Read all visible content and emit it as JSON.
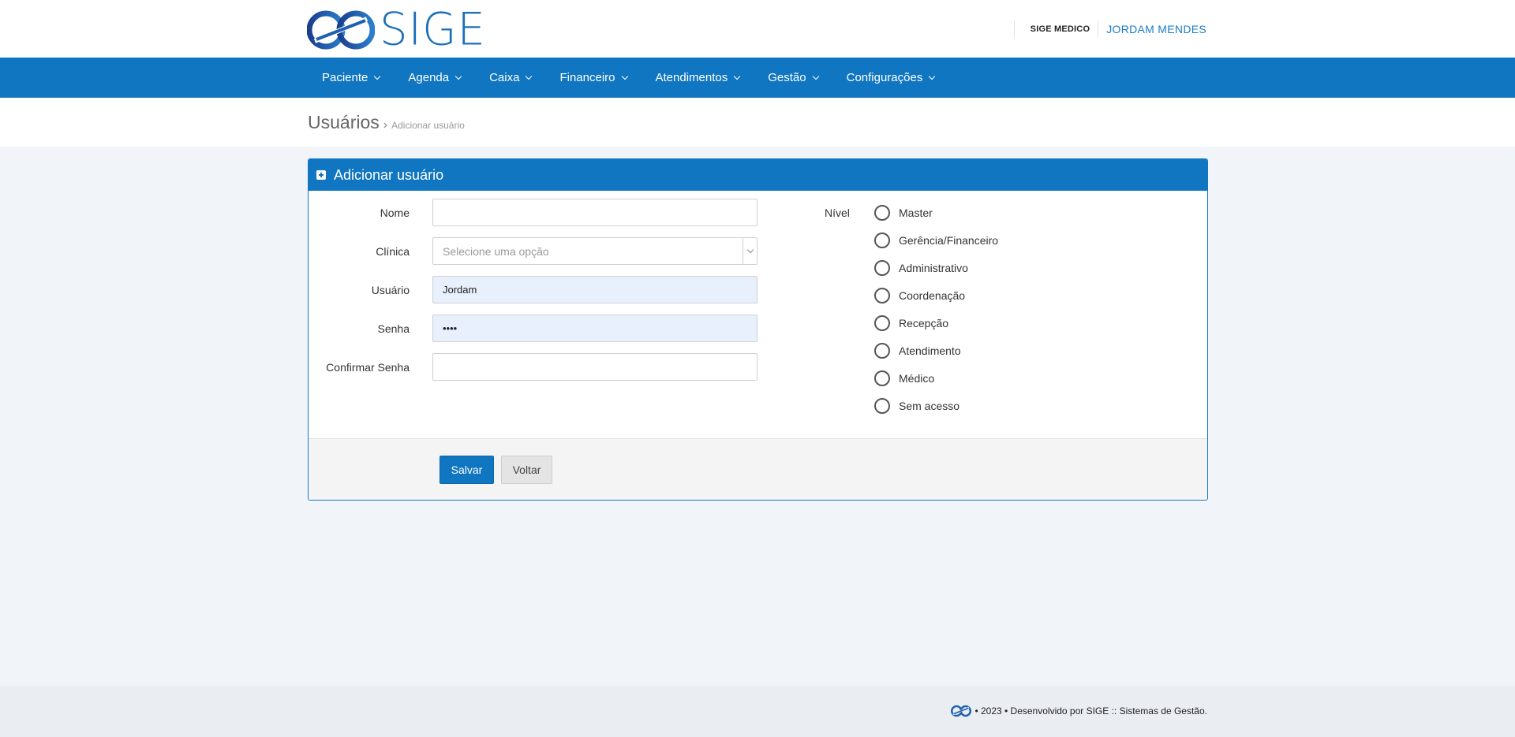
{
  "header": {
    "logo_text": "SIGE",
    "app_label": "SIGE MEDICO",
    "user_name": "JORDAM MENDES"
  },
  "nav": {
    "items": [
      {
        "label": "Paciente"
      },
      {
        "label": "Agenda"
      },
      {
        "label": "Caixa"
      },
      {
        "label": "Financeiro"
      },
      {
        "label": "Atendimentos"
      },
      {
        "label": "Gestão"
      },
      {
        "label": "Configurações"
      }
    ]
  },
  "breadcrumb": {
    "title": "Usuários",
    "separator": "›",
    "current": "Adicionar usuário"
  },
  "form": {
    "title": "Adicionar usuário",
    "fields": {
      "nome": {
        "label": "Nome",
        "value": ""
      },
      "clinica": {
        "label": "Clínica",
        "placeholder": "Selecione uma opção"
      },
      "usuario": {
        "label": "Usuário",
        "value": "Jordam"
      },
      "senha": {
        "label": "Senha",
        "value": "••••"
      },
      "confirmar_senha": {
        "label": "Confirmar Senha",
        "value": ""
      }
    },
    "nivel": {
      "label": "Nível",
      "options": [
        {
          "label": "Master"
        },
        {
          "label": "Gerência/Financeiro"
        },
        {
          "label": "Administrativo"
        },
        {
          "label": "Coordenação"
        },
        {
          "label": "Recepção"
        },
        {
          "label": "Atendimento"
        },
        {
          "label": "Médico"
        },
        {
          "label": "Sem acesso"
        }
      ]
    },
    "buttons": {
      "save": "Salvar",
      "back": "Voltar"
    }
  },
  "footer": {
    "text": "• 2023 • Desenvolvido por SIGE :: Sistemas de Gestão."
  },
  "colors": {
    "brand": "#1176c1",
    "user_link": "#1a7cc9",
    "page_bg": "#f1f5f9"
  }
}
